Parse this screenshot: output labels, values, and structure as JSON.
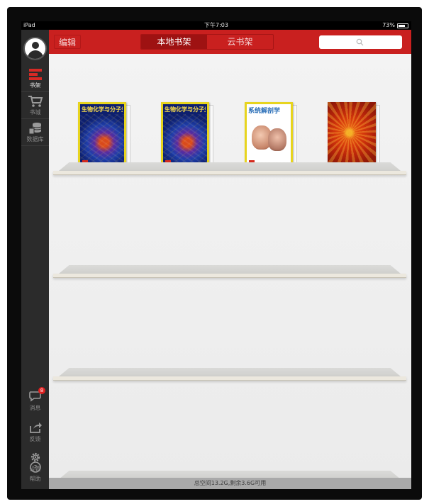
{
  "status_bar": {
    "device": "iPad",
    "time": "下午7:03",
    "battery": "73%",
    "battery_level": 0.73
  },
  "sidebar": {
    "nav": [
      {
        "label": "书架",
        "icon": "bookshelf-icon",
        "active": true
      },
      {
        "label": "书城",
        "icon": "cart-icon",
        "active": false
      },
      {
        "label": "数据库",
        "icon": "database-icon",
        "active": false
      }
    ],
    "bottom": [
      {
        "label": "消息",
        "icon": "message-icon",
        "badge": "8"
      },
      {
        "label": "反馈",
        "icon": "share-icon"
      },
      {
        "label": "设置",
        "icon": "gear-icon"
      },
      {
        "label": "帮助",
        "icon": "help-icon"
      }
    ]
  },
  "header": {
    "edit_label": "编辑",
    "tabs": [
      {
        "label": "本地书架",
        "active": true
      },
      {
        "label": "云书架",
        "active": false
      }
    ],
    "search_placeholder": ""
  },
  "books": [
    {
      "title": "生物化学与分子生物学",
      "style": "bio"
    },
    {
      "title": "生物化学与分子生物学",
      "style": "bio"
    },
    {
      "title": "系统解剖学",
      "style": "anatomy"
    },
    {
      "title": "",
      "style": "flower"
    }
  ],
  "footer": {
    "storage_text": "总空间13.2G,剩余3.6G可用"
  },
  "colors": {
    "accent": "#c9201f",
    "sidebar_bg": "#2b2b2b",
    "badge": "#e02020"
  }
}
